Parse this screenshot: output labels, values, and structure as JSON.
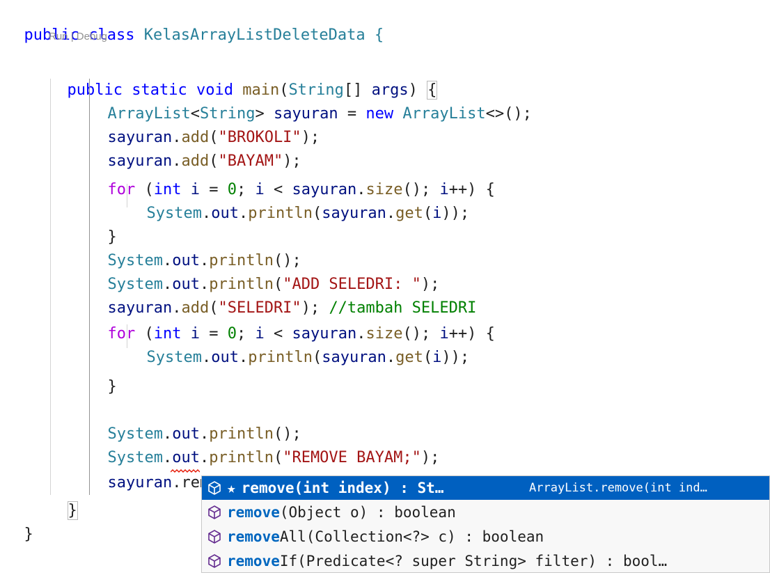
{
  "code_lens": {
    "run": "Run",
    "sep": " | ",
    "debug": "Debug"
  },
  "code": {
    "l1": {
      "a": "public",
      "b": " ",
      "c": "class",
      "d": " KelasArrayListDeleteData {"
    },
    "l2": {
      "a": "public",
      "b": " ",
      "c": "static",
      "d": " ",
      "e": "void",
      "f": " ",
      "g": "main",
      "h": "(",
      "i": "String",
      "j": "[] ",
      "k": "args",
      "l": ") ",
      "m": "{"
    },
    "l3": {
      "a": "ArrayList",
      "b": "<",
      "c": "String",
      "d": "> ",
      "e": "sayuran",
      "f": " = ",
      "g": "new",
      "h": " ",
      "i": "ArrayList",
      "j": "<>();"
    },
    "l4": {
      "a": "sayuran",
      "b": ".",
      "c": "add",
      "d": "(",
      "e": "\"BROKOLI\"",
      "f": ");"
    },
    "l5": {
      "a": "sayuran",
      "b": ".",
      "c": "add",
      "d": "(",
      "e": "\"BAYAM\"",
      "f": ");"
    },
    "l6": {
      "a": "for",
      "b": " (",
      "c": "int",
      "d": " ",
      "e": "i",
      "f": " = ",
      "g": "0",
      "h": "; ",
      "i": "i",
      "j": " < ",
      "k": "sayuran",
      "l": ".",
      "m": "size",
      "n": "(); ",
      "o": "i",
      "p": "++) {"
    },
    "l7": {
      "a": "System",
      "b": ".",
      "c": "out",
      "d": ".",
      "e": "println",
      "f": "(",
      "g": "sayuran",
      "h": ".",
      "i": "get",
      "j": "(",
      "k": "i",
      "l": "));"
    },
    "l8": {
      "a": "}"
    },
    "l9": {
      "a": "System",
      "b": ".",
      "c": "out",
      "d": ".",
      "e": "println",
      "f": "();"
    },
    "l10": {
      "a": "System",
      "b": ".",
      "c": "out",
      "d": ".",
      "e": "println",
      "f": "(",
      "g": "\"ADD SELEDRI: \"",
      "h": ");"
    },
    "l11": {
      "a": "sayuran",
      "b": ".",
      "c": "add",
      "d": "(",
      "e": "\"SELEDRI\"",
      "f": "); ",
      "g": "//tambah SELEDRI"
    },
    "l12": {
      "a": "for",
      "b": " (",
      "c": "int",
      "d": " ",
      "e": "i",
      "f": " = ",
      "g": "0",
      "h": "; ",
      "i": "i",
      "j": " < ",
      "k": "sayuran",
      "l": ".",
      "m": "size",
      "n": "(); ",
      "o": "i",
      "p": "++) {"
    },
    "l13": {
      "a": "System",
      "b": ".",
      "c": "out",
      "d": ".",
      "e": "println",
      "f": "(",
      "g": "sayuran",
      "h": ".",
      "i": "get",
      "j": "(",
      "k": "i",
      "l": "));"
    },
    "l14": {
      "a": "}"
    },
    "l15": {
      "a": "System",
      "b": ".",
      "c": "out",
      "d": ".",
      "e": "println",
      "f": "();"
    },
    "l16": {
      "a": "System",
      "b": ".",
      "c": "out",
      "d": ".",
      "e": "println",
      "f": "(",
      "g": "\"REMOVE BAYAM;\"",
      "h": ");"
    },
    "l17": {
      "a": "sayuran",
      "b": ".",
      "c": "rem"
    },
    "l18": {
      "a": "}"
    },
    "l19": {
      "a": "}"
    }
  },
  "suggestions": [
    {
      "star": "★",
      "match": "remove",
      "rest": "(int index) : St…",
      "detail": "ArrayList.remove(int ind…",
      "selected": true
    },
    {
      "match": "remove",
      "rest": "(Object o) : boolean"
    },
    {
      "match": "remove",
      "rest": "All(Collection<?> c) : boolean"
    },
    {
      "match": "remove",
      "rest": "If(Predicate<? super String> filter) : bool…"
    }
  ],
  "colors": {
    "keyword": "#0000ff",
    "type": "#267f99",
    "function": "#795e26",
    "string": "#a31515",
    "variable": "#001080",
    "comment": "#008000",
    "selection": "#0060c0"
  },
  "icons": {
    "method": "method-cube-icon"
  }
}
